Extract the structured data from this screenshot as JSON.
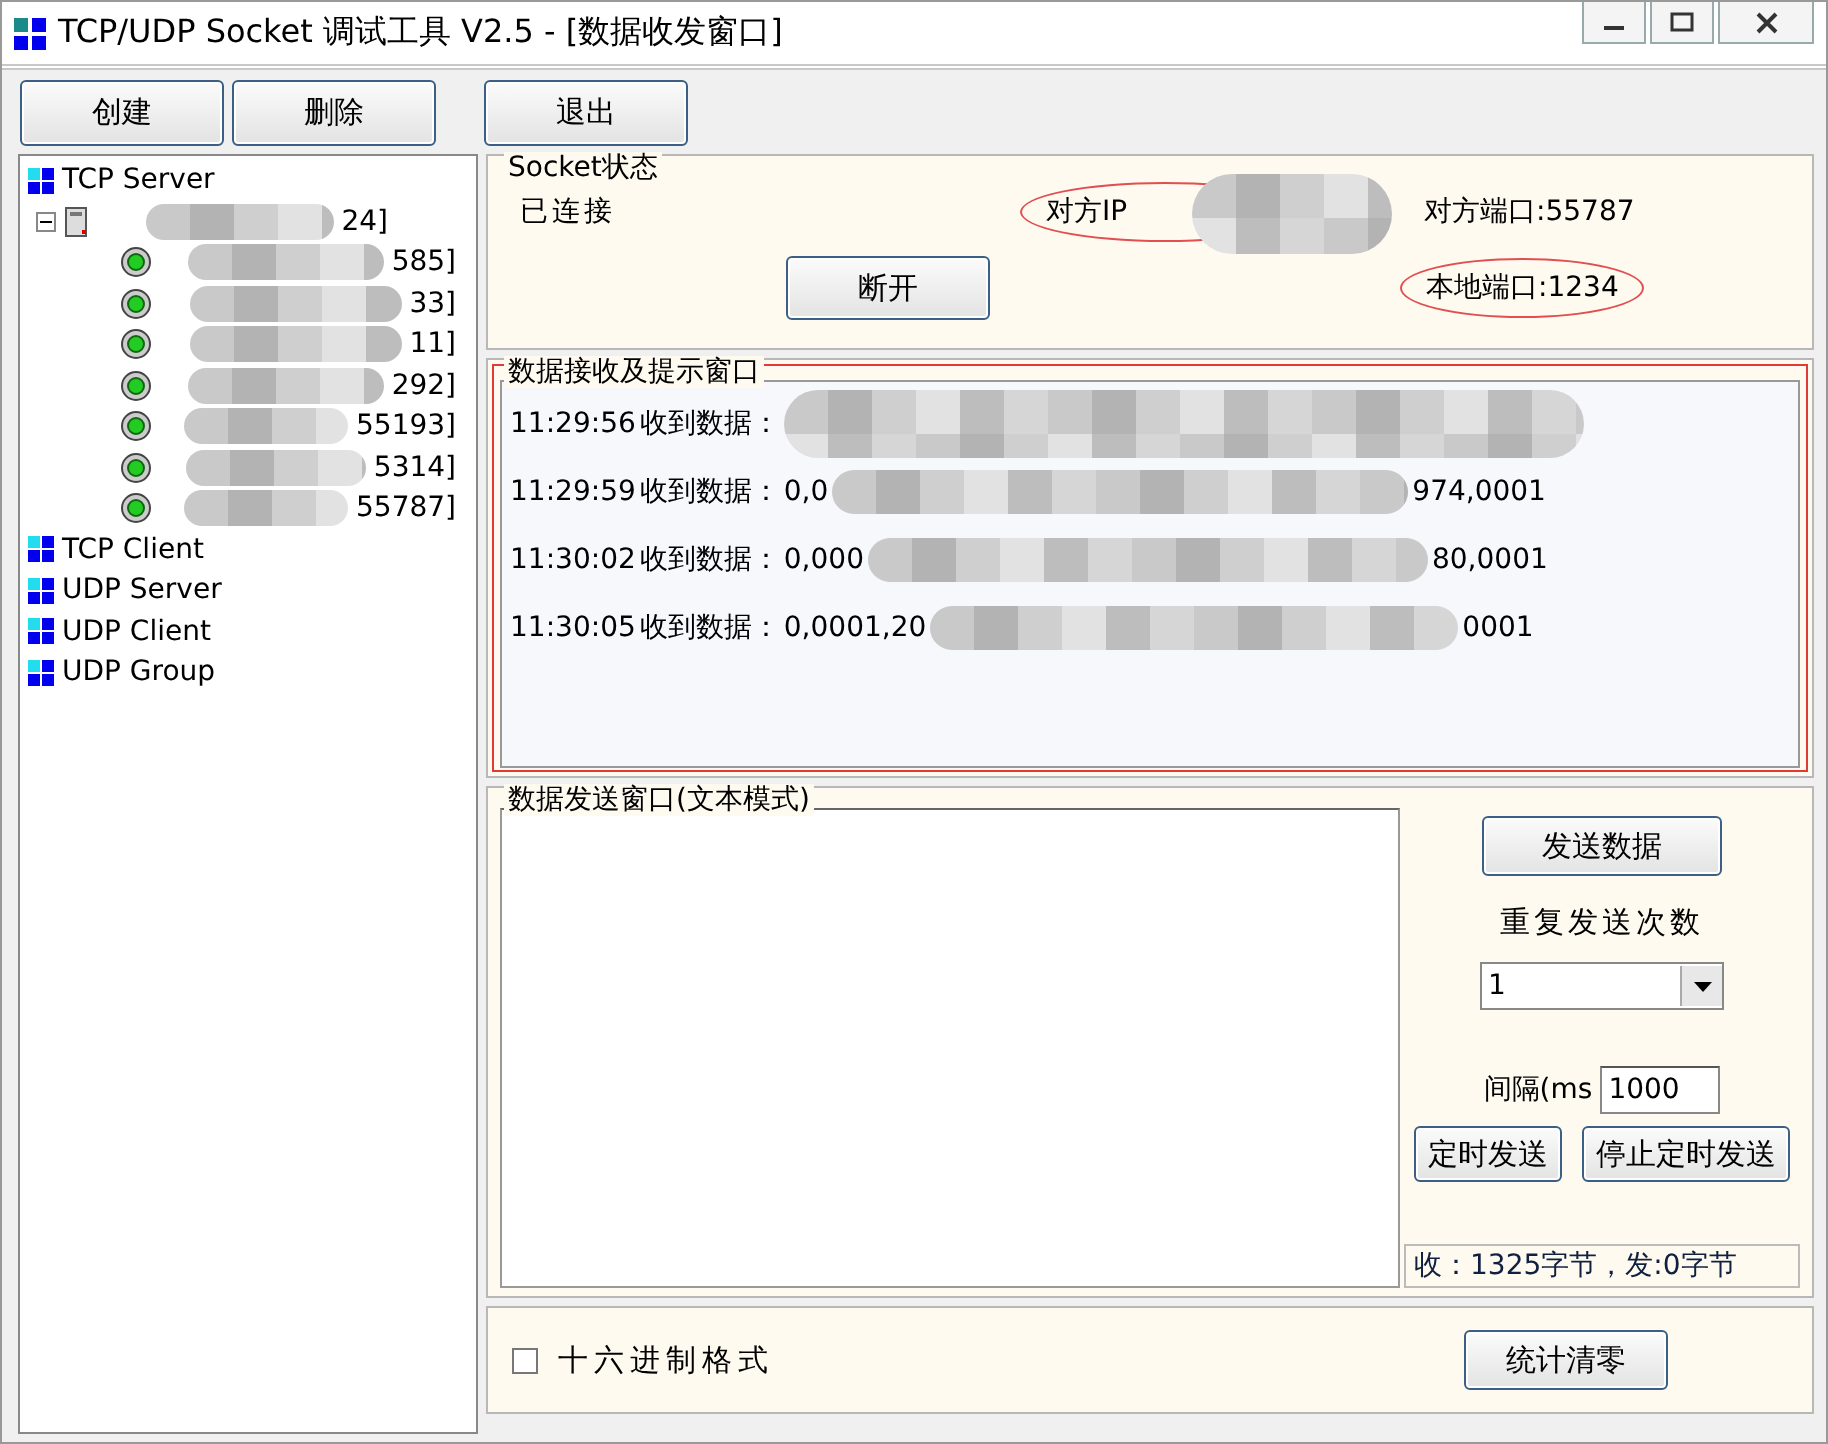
{
  "window": {
    "title": "TCP/UDP Socket 调试工具 V2.5 - [数据收发窗口]"
  },
  "toolbar": [
    "创建",
    "删除",
    "退出"
  ],
  "tree": [
    {
      "label": "TCP Server",
      "children": [
        {
          "label": "24]",
          "expanded": true,
          "children": [
            {
              "label": "585]"
            },
            {
              "label": "33]"
            },
            {
              "label": "11]"
            },
            {
              "label": "292]"
            },
            {
              "label": "55193]"
            },
            {
              "label": "5314]"
            },
            {
              "label": "55787]"
            }
          ]
        }
      ]
    },
    {
      "label": "TCP Client"
    },
    {
      "label": "UDP Server"
    },
    {
      "label": "UDP Client"
    },
    {
      "label": "UDP Group"
    }
  ],
  "socket_status": {
    "title": "Socket状态",
    "status": "已连接",
    "disconnect_button": "断开",
    "peer_ip": {
      "label": "对方IP",
      "highlighted": true
    },
    "peer_port": {
      "label": "对方端口:55787",
      "highlighted": false
    },
    "local_port": {
      "label": "本地端口:1234",
      "highlighted": true
    }
  },
  "receive": {
    "title": "数据接收及提示窗口",
    "highlighted": true,
    "lines": [
      {
        "time": "11:29:56",
        "label": "收到数据："
      },
      {
        "time": "11:29:59",
        "label": "收到数据：",
        "head": "0,0",
        "tail": "974,0001"
      },
      {
        "time": "11:30:02",
        "label": "收到数据：",
        "head": "0,000",
        "tail": "80,0001"
      },
      {
        "time": "11:30:05",
        "label": "收到数据：",
        "head": "0,0001,20",
        "tail": "0001"
      }
    ]
  },
  "send": {
    "title": "数据发送窗口(文本模式)",
    "send_button": "发送数据",
    "repeat_label": "重复发送次数",
    "repeat_value": "1",
    "interval_label": "间隔(ms",
    "interval_value": "1000",
    "timer_button": "定时发送",
    "stop_timer_button": "停止定时发送",
    "stats": "收：1325字节，发:0字节"
  },
  "bottom": {
    "hex": {
      "label": "十六进制格式",
      "checked": false
    },
    "clear_button": "统计清零"
  }
}
